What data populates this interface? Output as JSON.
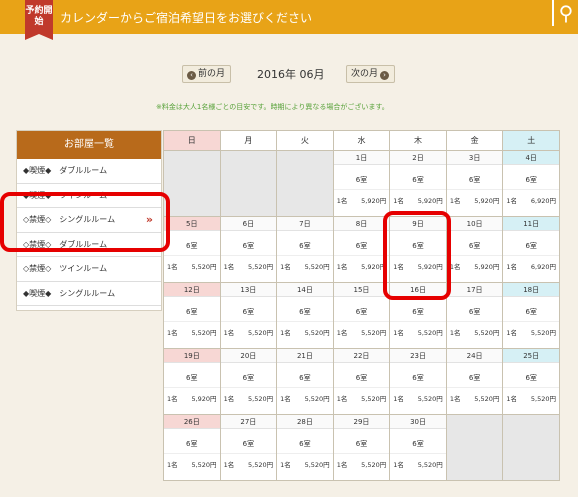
{
  "header": {
    "badge": "予約開始",
    "title": "カレンダーからご宿泊希望日をお選びください"
  },
  "nav": {
    "prev": "前の月",
    "current": "2016年 06月",
    "next": "次の月",
    "note": "※料金は大人1名様ごとの目安です。時期により異なる場合がございます。"
  },
  "rooms": {
    "heading": "お部屋一覧",
    "items": [
      {
        "label": "◆喫煙◆　ダブルルーム",
        "active": false
      },
      {
        "label": "◆喫煙◆　ツインルーム",
        "active": false
      },
      {
        "label": "◇禁煙◇　シングルルーム",
        "active": true
      },
      {
        "label": "◇禁煙◇　ダブルルーム",
        "active": false
      },
      {
        "label": "◇禁煙◇　ツインルーム",
        "active": false
      },
      {
        "label": "◆喫煙◆　シングルルーム",
        "active": false
      }
    ]
  },
  "calendar": {
    "weekdays": [
      "日",
      "月",
      "火",
      "水",
      "木",
      "金",
      "土"
    ],
    "weeks": [
      [
        null,
        null,
        null,
        {
          "day": "1日",
          "rooms": "6室",
          "qty": "1名",
          "price": "5,920円"
        },
        {
          "day": "2日",
          "rooms": "6室",
          "qty": "1名",
          "price": "5,920円"
        },
        {
          "day": "3日",
          "rooms": "6室",
          "qty": "1名",
          "price": "5,920円"
        },
        {
          "day": "4日",
          "rooms": "6室",
          "qty": "1名",
          "price": "6,920円"
        }
      ],
      [
        {
          "day": "5日",
          "rooms": "6室",
          "qty": "1名",
          "price": "5,520円"
        },
        {
          "day": "6日",
          "rooms": "6室",
          "qty": "1名",
          "price": "5,520円"
        },
        {
          "day": "7日",
          "rooms": "6室",
          "qty": "1名",
          "price": "5,520円"
        },
        {
          "day": "8日",
          "rooms": "6室",
          "qty": "1名",
          "price": "5,920円"
        },
        {
          "day": "9日",
          "rooms": "6室",
          "qty": "1名",
          "price": "5,920円"
        },
        {
          "day": "10日",
          "rooms": "6室",
          "qty": "1名",
          "price": "5,920円"
        },
        {
          "day": "11日",
          "rooms": "6室",
          "qty": "1名",
          "price": "6,920円"
        }
      ],
      [
        {
          "day": "12日",
          "rooms": "6室",
          "qty": "1名",
          "price": "5,520円"
        },
        {
          "day": "13日",
          "rooms": "6室",
          "qty": "1名",
          "price": "5,520円"
        },
        {
          "day": "14日",
          "rooms": "6室",
          "qty": "1名",
          "price": "5,520円"
        },
        {
          "day": "15日",
          "rooms": "6室",
          "qty": "1名",
          "price": "5,520円"
        },
        {
          "day": "16日",
          "rooms": "6室",
          "qty": "1名",
          "price": "5,520円"
        },
        {
          "day": "17日",
          "rooms": "6室",
          "qty": "1名",
          "price": "5,520円"
        },
        {
          "day": "18日",
          "rooms": "6室",
          "qty": "1名",
          "price": "5,520円"
        }
      ],
      [
        {
          "day": "19日",
          "rooms": "6室",
          "qty": "1名",
          "price": "5,920円"
        },
        {
          "day": "20日",
          "rooms": "6室",
          "qty": "1名",
          "price": "5,520円"
        },
        {
          "day": "21日",
          "rooms": "6室",
          "qty": "1名",
          "price": "5,520円"
        },
        {
          "day": "22日",
          "rooms": "6室",
          "qty": "1名",
          "price": "5,520円"
        },
        {
          "day": "23日",
          "rooms": "6室",
          "qty": "1名",
          "price": "5,520円"
        },
        {
          "day": "24日",
          "rooms": "6室",
          "qty": "1名",
          "price": "5,520円"
        },
        {
          "day": "25日",
          "rooms": "6室",
          "qty": "1名",
          "price": "5,520円"
        }
      ],
      [
        {
          "day": "26日",
          "rooms": "6室",
          "qty": "1名",
          "price": "5,520円"
        },
        {
          "day": "27日",
          "rooms": "6室",
          "qty": "1名",
          "price": "5,520円"
        },
        {
          "day": "28日",
          "rooms": "6室",
          "qty": "1名",
          "price": "5,520円"
        },
        {
          "day": "29日",
          "rooms": "6室",
          "qty": "1名",
          "price": "5,520円"
        },
        {
          "day": "30日",
          "rooms": "6室",
          "qty": "1名",
          "price": "5,520円"
        },
        null,
        null
      ]
    ]
  },
  "colors": {
    "accent": "#e8a317",
    "room_header": "#b86a1b",
    "sunday": "#f7d7d4",
    "saturday": "#d6f0f5",
    "highlight_ring": "#e60000"
  }
}
